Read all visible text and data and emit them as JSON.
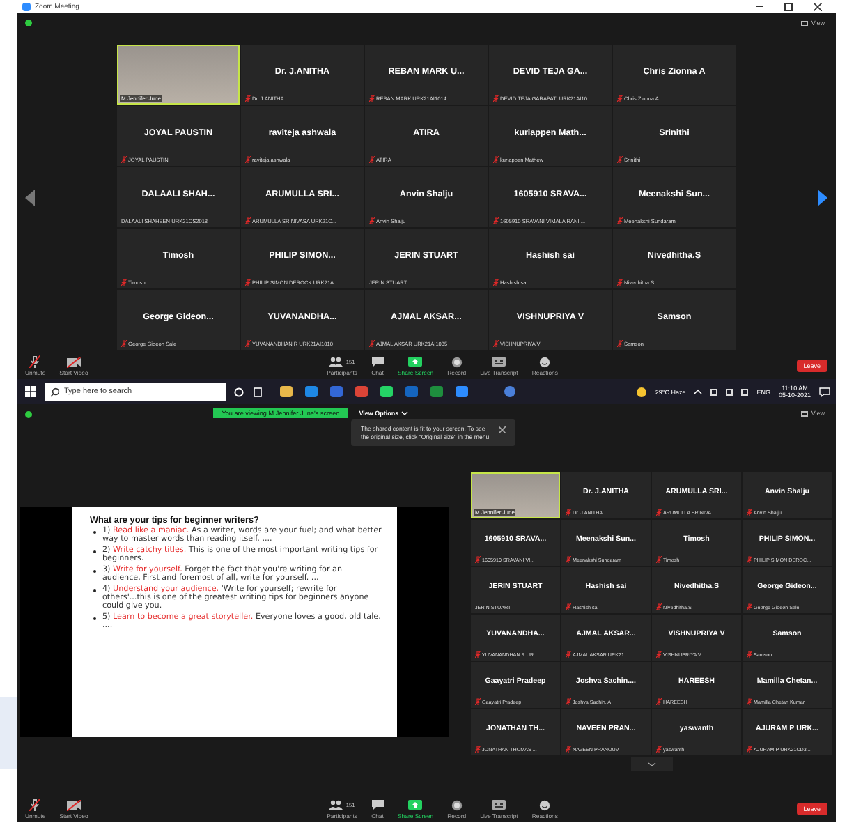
{
  "top_window": {
    "title": "Zoom Meeting",
    "view_button": "View",
    "gallery": [
      {
        "kind": "video",
        "label": "M Jennifer June"
      },
      {
        "kind": "name",
        "name": "Dr. J.ANITHA",
        "label": "Dr. J.ANITHA",
        "muted": true
      },
      {
        "kind": "name",
        "name": "REBAN MARK U...",
        "label": "REBAN MARK URK21AI1014",
        "muted": true
      },
      {
        "kind": "name",
        "name": "DEVID TEJA GA...",
        "label": "DEVID TEJA GARAPATI URK21AI10...",
        "muted": true
      },
      {
        "kind": "name",
        "name": "Chris Zionna A",
        "label": "Chris Zionna A",
        "muted": true
      },
      {
        "kind": "name",
        "name": "JOYAL PAUSTIN",
        "label": "JOYAL PAUSTIN",
        "muted": true
      },
      {
        "kind": "name",
        "name": "raviteja ashwala",
        "label": "raviteja ashwala",
        "muted": true
      },
      {
        "kind": "name",
        "name": "ATIRA",
        "label": "ATIRA",
        "muted": true
      },
      {
        "kind": "name",
        "name": "kuriappen Math...",
        "label": "kuriappen Mathew",
        "muted": true
      },
      {
        "kind": "name",
        "name": "Srinithi",
        "label": "Srinithi",
        "muted": true
      },
      {
        "kind": "name",
        "name": "DALAALI SHAH...",
        "label": "DALAALI SHAHEEN URK21CS2018",
        "muted": false
      },
      {
        "kind": "name",
        "name": "ARUMULLA SRI...",
        "label": "ARUMULLA SRINIVASA URK21C...",
        "muted": true
      },
      {
        "kind": "name",
        "name": "Anvin Shalju",
        "label": "Anvin Shalju",
        "muted": true
      },
      {
        "kind": "name",
        "name": "1605910 SRAVA...",
        "label": "1605910 SRAVANI VIMALA RANI ...",
        "muted": true
      },
      {
        "kind": "name",
        "name": "Meenakshi Sun...",
        "label": "Meenakshi Sundaram",
        "muted": true
      },
      {
        "kind": "name",
        "name": "Timosh",
        "label": "Timosh",
        "muted": true
      },
      {
        "kind": "name",
        "name": "PHILIP SIMON...",
        "label": "PHILIP SIMON DEROCK URK21A...",
        "muted": true
      },
      {
        "kind": "name",
        "name": "JERIN STUART",
        "label": "JERIN STUART",
        "muted": false
      },
      {
        "kind": "name",
        "name": "Hashish sai",
        "label": "Hashish sai",
        "muted": true
      },
      {
        "kind": "name",
        "name": "Nivedhitha.S",
        "label": "Nivedhitha.S",
        "muted": true
      },
      {
        "kind": "name",
        "name": "George Gideon...",
        "label": "George Gideon Sale",
        "muted": true
      },
      {
        "kind": "name",
        "name": "YUVANANDHA...",
        "label": "YUVANANDHAN R URK21AI1010",
        "muted": true
      },
      {
        "kind": "name",
        "name": "AJMAL AKSAR...",
        "label": "AJMAL AKSAR URK21AI1035",
        "muted": true
      },
      {
        "kind": "name",
        "name": "VISHNUPRIYA V",
        "label": "VISHNUPRIYA V",
        "muted": true
      },
      {
        "kind": "name",
        "name": "Samson",
        "label": "Samson",
        "muted": true
      }
    ],
    "toolbar": [
      {
        "kind": "mic",
        "label": "Unmute"
      },
      {
        "kind": "video",
        "label": "Start Video"
      },
      {
        "kind": "participants",
        "label": "Participants",
        "count": "151"
      },
      {
        "kind": "chat",
        "label": "Chat"
      },
      {
        "kind": "share",
        "label": "Share Screen"
      },
      {
        "kind": "record",
        "label": "Record"
      },
      {
        "kind": "transcript",
        "label": "Live Transcript"
      },
      {
        "kind": "reactions",
        "label": "Reactions"
      }
    ],
    "leave": "Leave"
  },
  "taskbar": {
    "search": {
      "placeholder": "Type here to search"
    },
    "weather": "29°C Haze",
    "language": "ENG",
    "time": "11:10 AM",
    "date": "05-10-2021"
  },
  "bottom_window": {
    "banner": "You are viewing M Jennifer June's screen",
    "view_options": "View Options",
    "view_button": "View",
    "tooltip": "The shared content is fit to your screen. To see the original size, click \"Original size\" in the menu.",
    "slide": {
      "heading": "What are your tips for beginner writers?",
      "bullets": [
        {
          "number": "1)",
          "highlight": "Read like a maniac.",
          "text": "As a writer, words are your fuel; and what better way to master words than reading itself. ...."
        },
        {
          "number": "2)",
          "highlight": "Write catchy titles.",
          "text": "This is one of the most important writing tips for beginners."
        },
        {
          "number": "3)",
          "highlight": "Write for yourself.",
          "text": "Forget the fact that you're writing for an audience. First and foremost of all, write for yourself. ..."
        },
        {
          "number": "4)",
          "highlight": "Understand your audience.",
          "text": "'Write for yourself; rewrite for others'...this is one of the greatest writing tips for beginners anyone could give you."
        },
        {
          "number": "5)",
          "highlight": "Learn to become a great storyteller.",
          "text": "Everyone loves a good, old tale. ...."
        }
      ]
    },
    "gallery": [
      {
        "kind": "video",
        "label": "M Jennifer June"
      },
      {
        "kind": "name",
        "name": "Dr. J.ANITHA",
        "label": "Dr. J.ANITHA",
        "muted": true
      },
      {
        "kind": "name",
        "name": "ARUMULLA SRI...",
        "label": "ARUMULLA SRINIVA...",
        "muted": true
      },
      {
        "kind": "name",
        "name": "Anvin Shalju",
        "label": "Anvin Shalju",
        "muted": true
      },
      {
        "kind": "name",
        "name": "1605910 SRAVA...",
        "label": "1605910 SRAVANI VI...",
        "muted": true
      },
      {
        "kind": "name",
        "name": "Meenakshi Sun...",
        "label": "Meenakshi Sundaram",
        "muted": true
      },
      {
        "kind": "name",
        "name": "Timosh",
        "label": "Timosh",
        "muted": true
      },
      {
        "kind": "name",
        "name": "PHILIP SIMON...",
        "label": "PHILIP SIMON DEROC...",
        "muted": true
      },
      {
        "kind": "name",
        "name": "JERIN STUART",
        "label": "JERIN STUART",
        "muted": false
      },
      {
        "kind": "name",
        "name": "Hashish sai",
        "label": "Hashish sai",
        "muted": true
      },
      {
        "kind": "name",
        "name": "Nivedhitha.S",
        "label": "Nivedhitha.S",
        "muted": true
      },
      {
        "kind": "name",
        "name": "George Gideon...",
        "label": "George Gideon Sale",
        "muted": true
      },
      {
        "kind": "name",
        "name": "YUVANANDHA...",
        "label": "YUVANANDHAN R UR...",
        "muted": true
      },
      {
        "kind": "name",
        "name": "AJMAL AKSAR...",
        "label": "AJMAL AKSAR URK21...",
        "muted": true
      },
      {
        "kind": "name",
        "name": "VISHNUPRIYA V",
        "label": "VISHNUPRIYA V",
        "muted": true
      },
      {
        "kind": "name",
        "name": "Samson",
        "label": "Samson",
        "muted": true
      },
      {
        "kind": "name",
        "name": "Gaayatri Pradeep",
        "label": "Gaayatri Pradeep",
        "muted": true
      },
      {
        "kind": "name",
        "name": "Joshva Sachin....",
        "label": "Joshva Sachin. A",
        "muted": true
      },
      {
        "kind": "name",
        "name": "HAREESH",
        "label": "HAREESH",
        "muted": true
      },
      {
        "kind": "name",
        "name": "Mamilla Chetan...",
        "label": "Mamilla Chetan Kumar",
        "muted": true
      },
      {
        "kind": "name",
        "name": "JONATHAN TH...",
        "label": "JONATHAN THOMAS ...",
        "muted": true
      },
      {
        "kind": "name",
        "name": "NAVEEN PRAN...",
        "label": "NAVEEN PRANOUV",
        "muted": true
      },
      {
        "kind": "name",
        "name": "yaswanth",
        "label": "yaswanth",
        "muted": true
      },
      {
        "kind": "name",
        "name": "AJURAM P URK...",
        "label": "AJURAM P URK21CD3...",
        "muted": true
      }
    ],
    "toolbar": [
      {
        "kind": "mic",
        "label": "Unmute"
      },
      {
        "kind": "video",
        "label": "Start Video"
      },
      {
        "kind": "participants",
        "label": "Participants",
        "count": "151"
      },
      {
        "kind": "chat",
        "label": "Chat"
      },
      {
        "kind": "share",
        "label": "Share Screen"
      },
      {
        "kind": "record",
        "label": "Record"
      },
      {
        "kind": "transcript",
        "label": "Live Transcript"
      },
      {
        "kind": "reactions",
        "label": "Reactions"
      }
    ],
    "leave": "Leave"
  }
}
